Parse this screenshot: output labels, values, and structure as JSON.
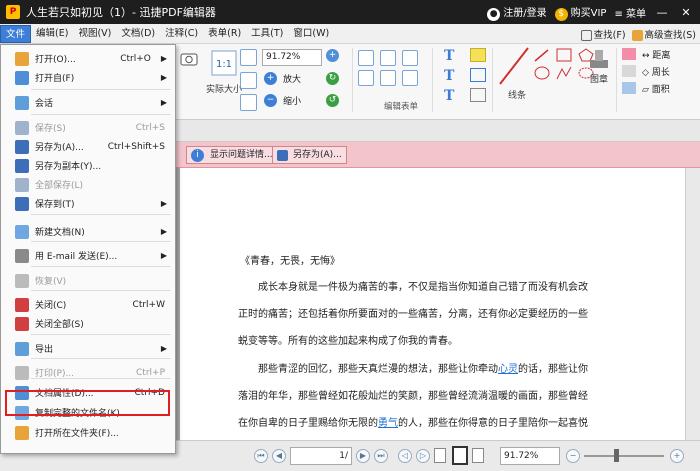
{
  "title": "人生若只如初见（1）- 迅捷PDF编辑器",
  "titlebar": {
    "login": "注册/登录",
    "vip": "购买VIP",
    "menu": "菜单"
  },
  "menubar": {
    "items": [
      "文件",
      "编辑(E)",
      "视图(V)",
      "文档(D)",
      "注释(C)",
      "表单(R)",
      "工具(T)",
      "窗口(W)"
    ],
    "find": "查找(F)",
    "adv_find": "高级查找(S)"
  },
  "toolbar": {
    "zoom": "91.72%",
    "actual_size": "实际大小",
    "zoom_in": "放大",
    "zoom_out": "缩小",
    "edit_form": "编辑表单",
    "lines": "线条",
    "drawing": "图章",
    "distance": "距离",
    "perimeter": "周长",
    "area": "面积"
  },
  "notice": {
    "show_details": "显示问题详情...",
    "save_as": "另存为(A)..."
  },
  "menu": [
    {
      "label": "打开(O)...",
      "shortcut": "Ctrl+O",
      "arrow": true,
      "disabled": false,
      "color": "#e8a33a"
    },
    {
      "label": "打开自(F)",
      "shortcut": "",
      "arrow": true,
      "disabled": false,
      "color": "#4f8fd8"
    },
    {
      "label": "会话",
      "shortcut": "",
      "arrow": true,
      "disabled": false,
      "color": "#5f9fd9"
    },
    {
      "label": "保存(S)",
      "shortcut": "Ctrl+S",
      "arrow": false,
      "disabled": true,
      "color": "#9fb3cc"
    },
    {
      "label": "另存为(A)...",
      "shortcut": "Ctrl+Shift+S",
      "arrow": false,
      "disabled": false,
      "color": "#3d6fb8"
    },
    {
      "label": "另存为副本(Y)...",
      "shortcut": "",
      "arrow": false,
      "disabled": false,
      "color": "#3d6fb8"
    },
    {
      "label": "全部保存(L)",
      "shortcut": "",
      "arrow": false,
      "disabled": true,
      "color": "#9fb3cc"
    },
    {
      "label": "保存到(T)",
      "shortcut": "",
      "arrow": true,
      "disabled": false,
      "color": "#3d6fb8"
    },
    {
      "label": "新建文档(N)",
      "shortcut": "",
      "arrow": true,
      "disabled": false,
      "color": "#6fa8e0"
    },
    {
      "label": "用 E-mail 发送(E)...",
      "shortcut": "",
      "arrow": true,
      "disabled": false,
      "color": "#8a8a8a"
    },
    {
      "label": "恢复(V)",
      "shortcut": "",
      "arrow": false,
      "disabled": true,
      "color": "#bbbbbb"
    },
    {
      "label": "关闭(C)",
      "shortcut": "Ctrl+W",
      "arrow": false,
      "disabled": false,
      "color": "#d04040"
    },
    {
      "label": "关闭全部(S)",
      "shortcut": "",
      "arrow": false,
      "disabled": false,
      "color": "#d04040"
    },
    {
      "label": "导出",
      "shortcut": "",
      "arrow": true,
      "disabled": false,
      "color": "#5f9fd9"
    },
    {
      "label": "打印(P)...",
      "shortcut": "Ctrl+P",
      "arrow": false,
      "disabled": true,
      "color": "#bbbbbb"
    },
    {
      "label": "文档属性(D)...",
      "shortcut": "Ctrl+D",
      "arrow": false,
      "disabled": false,
      "color": "#4f8fd8"
    },
    {
      "label": "复制完整的文件名(K)",
      "shortcut": "",
      "arrow": false,
      "disabled": false,
      "color": "#6fa8e0"
    },
    {
      "label": "打开所在文件夹(F)...",
      "shortcut": "",
      "arrow": false,
      "disabled": false,
      "color": "#e8a33a"
    }
  ],
  "doc": {
    "title": "《青春，无畏，无悔》",
    "lines": [
      "成长本身就是一件极为痛苦的事，不仅是指当你知道自己错了而没有机会改",
      "正时的痛苦；还包括着你所要面对的一些痛苦，分离，还有你必定要经历的一些",
      "蜕变等等。所有的这些加起来构成了你我的青春。"
    ],
    "p2a": "那些青涩的回忆，那些天真烂漫的想法，那些让你牵动",
    "p2link": "心灵",
    "p2b": "的话，那些让你",
    "p3": "落泪的年华，那些曾经如花般灿烂的笑颜，那些曾经流淌温暖的画面，那些曾经",
    "p4a": "在你自卑的日子里赐给你无限的",
    "p4link": "勇气",
    "p4b": "的人，那些在你得意的日子里陪你一起喜悦"
  },
  "status": {
    "page": "1/",
    "zoom": "91.72%"
  }
}
